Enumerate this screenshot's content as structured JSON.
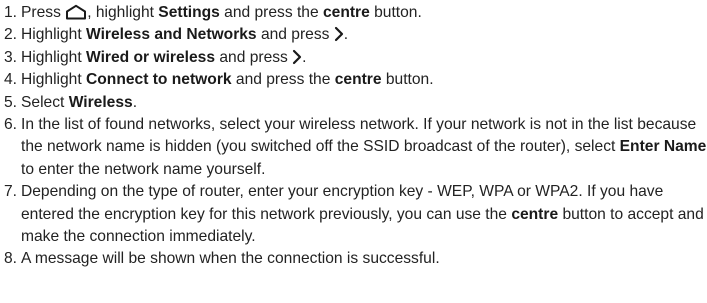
{
  "steps": [
    {
      "num": "1.",
      "parts": [
        {
          "t": "Press "
        },
        {
          "icon": "home-icon"
        },
        {
          "t": ", highlight "
        },
        {
          "t": "Settings",
          "b": true
        },
        {
          "t": " and press the "
        },
        {
          "t": "centre",
          "b": true
        },
        {
          "t": " button."
        }
      ]
    },
    {
      "num": "2.",
      "parts": [
        {
          "t": "Highlight "
        },
        {
          "t": "Wireless and Networks",
          "b": true
        },
        {
          "t": " and press "
        },
        {
          "icon": "chevron-right-icon"
        },
        {
          "t": "."
        }
      ]
    },
    {
      "num": "3.",
      "parts": [
        {
          "t": "Highlight "
        },
        {
          "t": "Wired or wireless",
          "b": true
        },
        {
          "t": " and press "
        },
        {
          "icon": "chevron-right-icon"
        },
        {
          "t": "."
        }
      ]
    },
    {
      "num": "4.",
      "parts": [
        {
          "t": "Highlight "
        },
        {
          "t": "Connect to network",
          "b": true
        },
        {
          "t": " and press the "
        },
        {
          "t": "centre",
          "b": true
        },
        {
          "t": " button."
        }
      ]
    },
    {
      "num": "5.",
      "parts": [
        {
          "t": "Select "
        },
        {
          "t": "Wireless",
          "b": true
        },
        {
          "t": "."
        }
      ]
    },
    {
      "num": "6.",
      "parts": [
        {
          "t": "In the list of found networks, select your wireless network. If your network is not in the list because the network name is hidden (you switched off the SSID broadcast of the router), select "
        },
        {
          "t": "Enter Name",
          "b": true
        },
        {
          "t": " to enter the network name yourself."
        }
      ]
    },
    {
      "num": "7.",
      "parts": [
        {
          "t": "Depending on the type of router, enter your encryption key - WEP, WPA or WPA2. If you have entered the encryption key for this network previously, you can use the "
        },
        {
          "t": "centre",
          "b": true
        },
        {
          "t": " button to accept and make the connection immediately."
        }
      ]
    },
    {
      "num": "8.",
      "parts": [
        {
          "t": "A message will be shown when the connection is successful."
        }
      ]
    }
  ]
}
